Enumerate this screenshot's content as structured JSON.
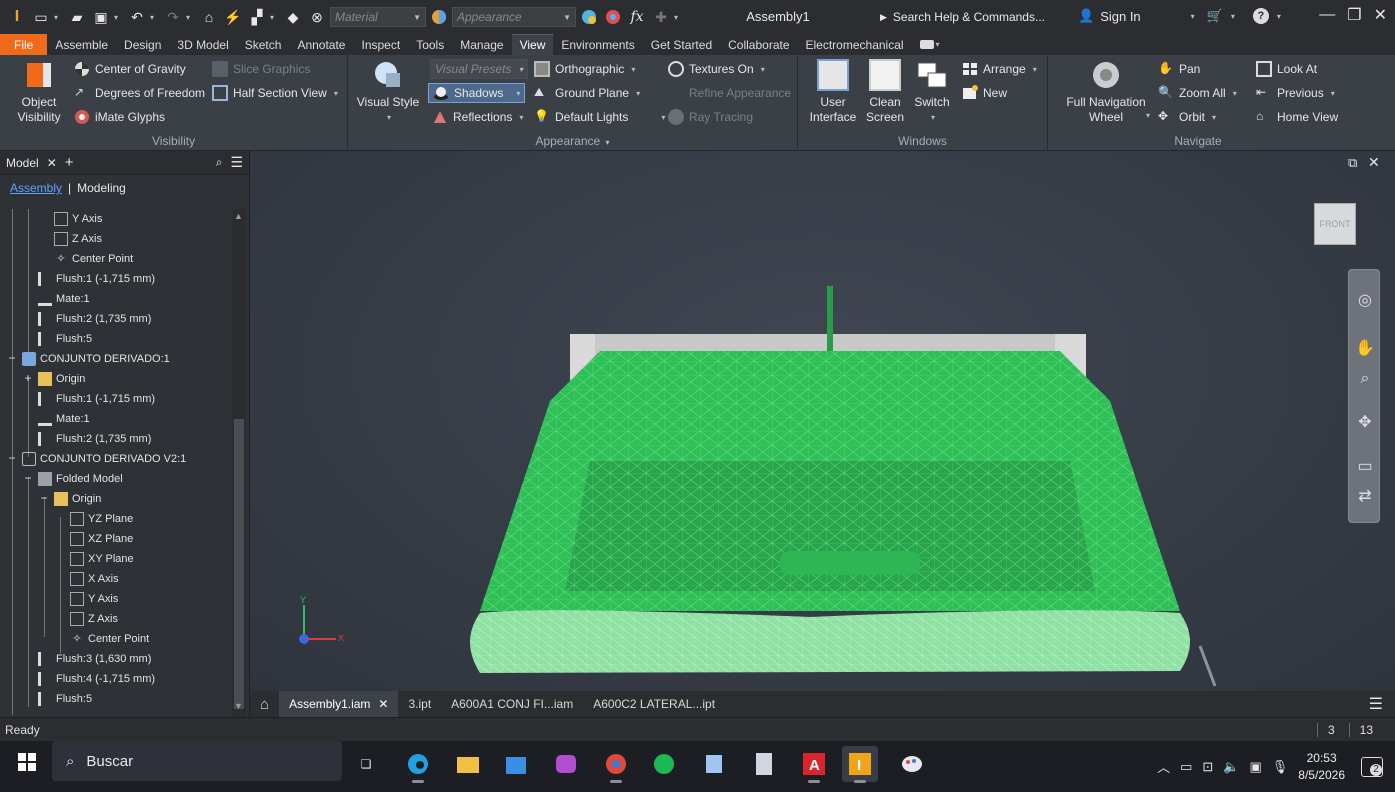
{
  "titlebar": {
    "material_placeholder": "Material",
    "appearance_placeholder": "Appearance",
    "doc_title": "Assembly1",
    "search": "Search Help & Commands...",
    "sign_in": "Sign In"
  },
  "tabs": [
    "File",
    "Assemble",
    "Design",
    "3D Model",
    "Sketch",
    "Annotate",
    "Inspect",
    "Tools",
    "Manage",
    "View",
    "Environments",
    "Get Started",
    "Collaborate",
    "Electromechanical"
  ],
  "active_tab": "View",
  "ribbon": {
    "visibility": {
      "label": "Visibility",
      "object_visibility": "Object\nVisibility",
      "center_of_gravity": "Center of Gravity",
      "degrees_of_freedom": "Degrees of Freedom",
      "imate_glyphs": "iMate Glyphs",
      "slice_graphics": "Slice Graphics",
      "half_section_view": "Half Section View"
    },
    "appearance": {
      "label": "Appearance",
      "visual_style": "Visual Style",
      "visual_presets": "Visual Presets",
      "shadows": "Shadows",
      "reflections": "Reflections",
      "orthographic": "Orthographic",
      "ground_plane": "Ground Plane",
      "default_lights": "Default Lights",
      "textures_on": "Textures On",
      "refine_appearance": "Refine Appearance",
      "ray_tracing": "Ray Tracing"
    },
    "windows": {
      "label": "Windows",
      "user_interface": "User\nInterface",
      "clean_screen": "Clean\nScreen",
      "switch": "Switch",
      "arrange": "Arrange",
      "new": "New"
    },
    "navigate": {
      "label": "Navigate",
      "full_navigation_wheel": "Full Navigation\nWheel",
      "pan": "Pan",
      "zoom_all": "Zoom All",
      "orbit": "Orbit",
      "look_at": "Look At",
      "previous": "Previous",
      "home_view": "Home View"
    }
  },
  "browser": {
    "title": "Model",
    "tab_assembly": "Assembly",
    "tab_modeling": "Modeling",
    "nodes": [
      "Y Axis",
      "Z Axis",
      "Center Point",
      "Flush:1 (-1,715 mm)",
      "Mate:1",
      "Flush:2 (1,735 mm)",
      "Flush:5",
      "CONJUNTO DERIVADO:1",
      "Origin",
      "Flush:1 (-1,715 mm)",
      "Mate:1",
      "Flush:2 (1,735 mm)",
      "CONJUNTO DERIVADO V2:1",
      "Folded Model",
      "Origin",
      "YZ Plane",
      "XZ Plane",
      "XY Plane",
      "X Axis",
      "Y Axis",
      "Z Axis",
      "Center Point",
      "Flush:3 (1,630 mm)",
      "Flush:4 (-1,715 mm)",
      "Flush:5"
    ]
  },
  "viewport": {
    "viewcube_label": "FRONT",
    "axis_x": "X",
    "axis_y": "Y"
  },
  "doc_tabs": [
    "Assembly1.iam",
    "3.ipt",
    "A600A1 CONJ FI...iam",
    "A600C2 LATERAL...ipt"
  ],
  "status": {
    "text": "Ready",
    "count_a": "3",
    "count_b": "13"
  },
  "taskbar": {
    "search": "Buscar",
    "time": "20:53",
    "date": "8/5/2026",
    "notifications": "2"
  },
  "colors": {
    "file_tab": "#f06a1a",
    "model_green": "#2fbf57",
    "accent_blue": "#5ea3ff"
  }
}
